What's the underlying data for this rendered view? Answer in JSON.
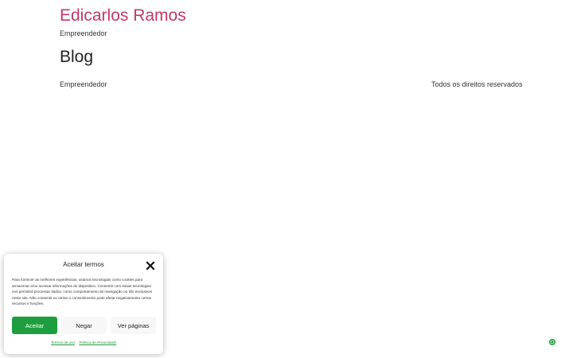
{
  "site": {
    "title": "Edicarlos Ramos",
    "tagline": "Empreendedor"
  },
  "main": {
    "heading": "Blog"
  },
  "footer": {
    "left_text": "Empreendedor",
    "right_text": "Todos os direitos reservados"
  },
  "consent": {
    "title": "Aceitar termos",
    "body": "Para fornecer as melhores experiências, usamos tecnologias como cookies para armazenar e/ou acessar informações do dispositivo. Consentir com essas tecnologias nos permitirá processar dados, como comportamento de navegação ou IDs exclusivos neste site. Não consentir ou retirar o consentimento pode afetar negativamente certos recursos e funções.",
    "accept_label": "Aceitar",
    "deny_label": "Negar",
    "prefs_label": "Ver páginas",
    "terms_link": "Termos de uso",
    "privacy_link": "Política de Privacidade",
    "accent_color": "#1e9e3e"
  },
  "colors": {
    "title": "#c2376b",
    "text": "#333333"
  }
}
